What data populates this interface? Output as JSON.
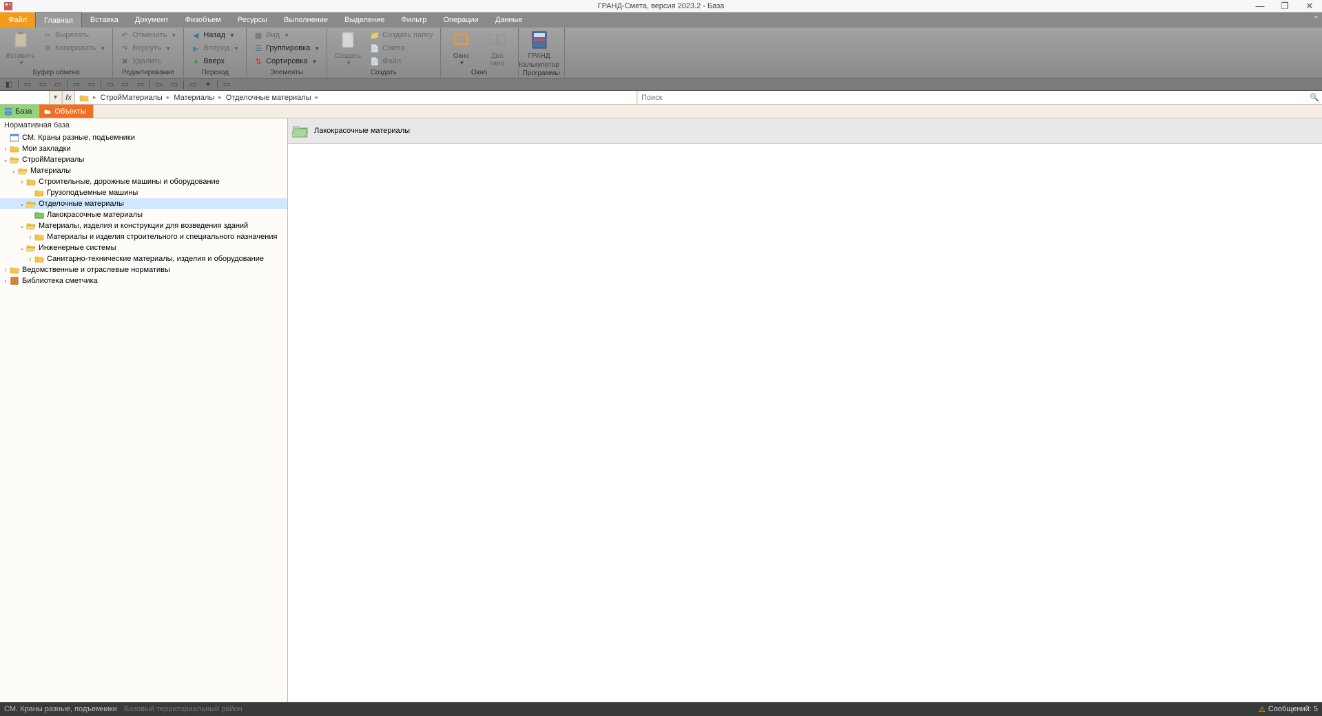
{
  "title": "ГРАНД-Смета, версия 2023.2 - База",
  "win": {
    "min": "—",
    "max": "❐",
    "close": "✕"
  },
  "tabs": {
    "file": "Файл",
    "items": [
      "Главная",
      "Вставка",
      "Документ",
      "Физобъем",
      "Ресурсы",
      "Выполнение",
      "Выделение",
      "Фильтр",
      "Операции",
      "Данные"
    ],
    "active": 0
  },
  "ribbon": {
    "clipboard": {
      "label": "Буфер обмена",
      "paste": "Вставить",
      "cut": "Вырезать",
      "copy": "Копировать"
    },
    "editing": {
      "label": "Редактирование",
      "undo": "Отменить",
      "redo": "Вернуть",
      "delete": "Удалить"
    },
    "nav": {
      "label": "Переход",
      "back": "Назад",
      "forward": "Вперед",
      "up": "Вверх"
    },
    "elements": {
      "label": "Элементы",
      "view": "Вид",
      "grouping": "Группировка",
      "sorting": "Сортировка"
    },
    "create": {
      "label": "Создать",
      "create": "Создать",
      "mkdir": "Создать папку",
      "smeta": "Смета",
      "file": "Файл"
    },
    "window": {
      "label": "Окно",
      "window": "Окно",
      "two": "Два\nокна"
    },
    "programs": {
      "label": "Программы",
      "grand": "ГРАНД",
      "calc": "Калькулятор"
    }
  },
  "address": {
    "fx": "fx",
    "segments": [
      "СтройМатериалы",
      "Материалы",
      "Отделочные материалы"
    ],
    "search_placeholder": "Поиск"
  },
  "doc_tabs": {
    "db": "База",
    "obj": "Объекты"
  },
  "tree": {
    "title": "Нормативная база",
    "nodes": [
      {
        "indent": 0,
        "tw": "",
        "icon": "db",
        "label": "СМ. Краны разные, подъемники",
        "sel": false
      },
      {
        "indent": 0,
        "tw": ">",
        "icon": "folder",
        "label": "Мои закладки",
        "sel": false
      },
      {
        "indent": 0,
        "tw": "v",
        "icon": "folder-open",
        "label": "СтройМатериалы",
        "sel": false
      },
      {
        "indent": 1,
        "tw": "v",
        "icon": "folder-open",
        "label": "Материалы",
        "sel": false
      },
      {
        "indent": 2,
        "tw": ">",
        "icon": "folder",
        "label": "Строительные, дорожные машины и оборудование",
        "sel": false
      },
      {
        "indent": 3,
        "tw": "",
        "icon": "folder",
        "label": "Грузоподъемные машины",
        "sel": false
      },
      {
        "indent": 2,
        "tw": "v",
        "icon": "folder-open",
        "label": "Отделочные материалы",
        "sel": true
      },
      {
        "indent": 3,
        "tw": "",
        "icon": "folder-green",
        "label": "Лакокрасочные материалы",
        "sel": false
      },
      {
        "indent": 2,
        "tw": "v",
        "icon": "folder-open",
        "label": "Материалы, изделия и конструкции для возведения зданий",
        "sel": false
      },
      {
        "indent": 3,
        "tw": ">",
        "icon": "folder",
        "label": "Материалы и изделия строительного и специального назначения",
        "sel": false
      },
      {
        "indent": 2,
        "tw": "v",
        "icon": "folder-open",
        "label": "Инженерные системы",
        "sel": false
      },
      {
        "indent": 3,
        "tw": ">",
        "icon": "folder",
        "label": "Санитарно-технические материалы, изделия и оборудование",
        "sel": false
      },
      {
        "indent": 0,
        "tw": ">",
        "icon": "folder",
        "label": "Ведомственные и отраслевые нормативы",
        "sel": false
      },
      {
        "indent": 0,
        "tw": ">",
        "icon": "book",
        "label": "Библиотека сметчика",
        "sel": false
      }
    ]
  },
  "content": {
    "items": [
      {
        "label": "Лакокрасочные материалы"
      }
    ]
  },
  "statusbar": {
    "left1": "СМ. Краны разные, подъемники",
    "left2": "Базовый территориальный район",
    "right": "Сообщений: 5"
  }
}
